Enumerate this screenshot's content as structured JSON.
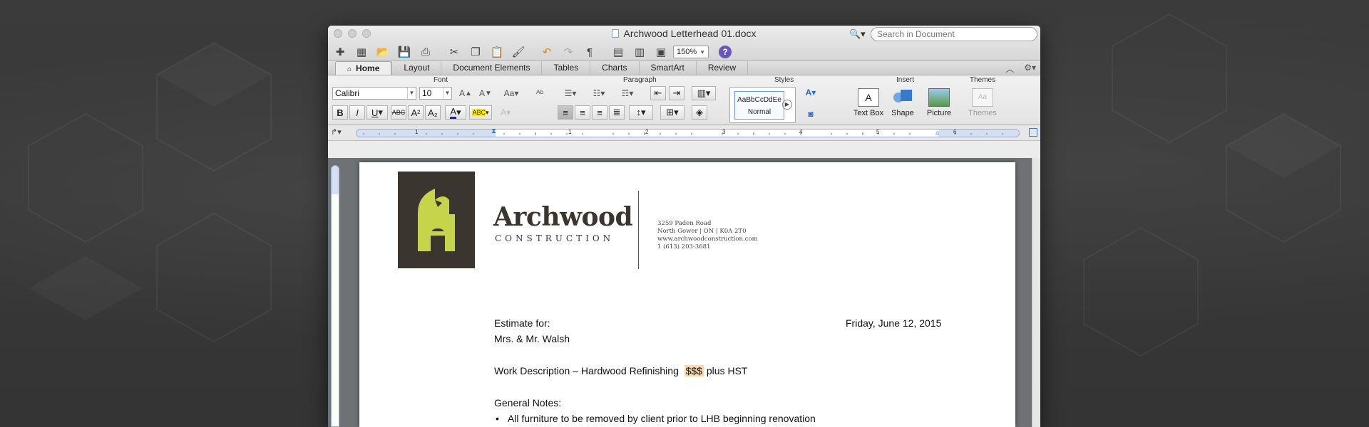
{
  "window": {
    "title": "Archwood Letterhead 01.docx"
  },
  "toolbar": {
    "zoom": "150%",
    "search_placeholder": "Search in Document"
  },
  "ribbon": {
    "tabs": [
      {
        "label": "Home"
      },
      {
        "label": "Layout"
      },
      {
        "label": "Document Elements"
      },
      {
        "label": "Tables"
      },
      {
        "label": "Charts"
      },
      {
        "label": "SmartArt"
      },
      {
        "label": "Review"
      }
    ],
    "groups": {
      "font": "Font",
      "paragraph": "Paragraph",
      "styles": "Styles",
      "insert": "Insert",
      "themes": "Themes"
    },
    "font_name": "Calibri",
    "font_size": "10",
    "style_preview": "AaBbCcDdEe",
    "style_name": "Normal",
    "insert_items": [
      "Text Box",
      "Shape",
      "Picture"
    ],
    "themes_label": "Themes"
  },
  "ruler": {
    "marks": [
      "1",
      "1",
      "2",
      "3",
      "4",
      "5",
      "6"
    ]
  },
  "letterhead": {
    "company": "Archwood",
    "tagline": "CONSTRUCTION",
    "address_lines": [
      "3259 Paden Road",
      "North Gower | ON | K0A 2T0",
      "www.archwoodconstruction.com",
      "1 (613) 203-3681"
    ]
  },
  "letter": {
    "estimate_for": "Estimate for:",
    "date": "Friday, June 12, 2015",
    "client": "Mrs. & Mr. Walsh",
    "work_prefix": "Work Description – Hardwood Refinishing",
    "price": "$$$",
    "work_suffix": "plus HST",
    "general_notes": "General Notes:",
    "bullet_1": "All furniture to be removed by client prior to LHB beginning renovation"
  },
  "colors": {
    "brand_dark": "#3b3530",
    "brand_green": "#c5d44a",
    "price_highlight": "#f6d9ad"
  }
}
